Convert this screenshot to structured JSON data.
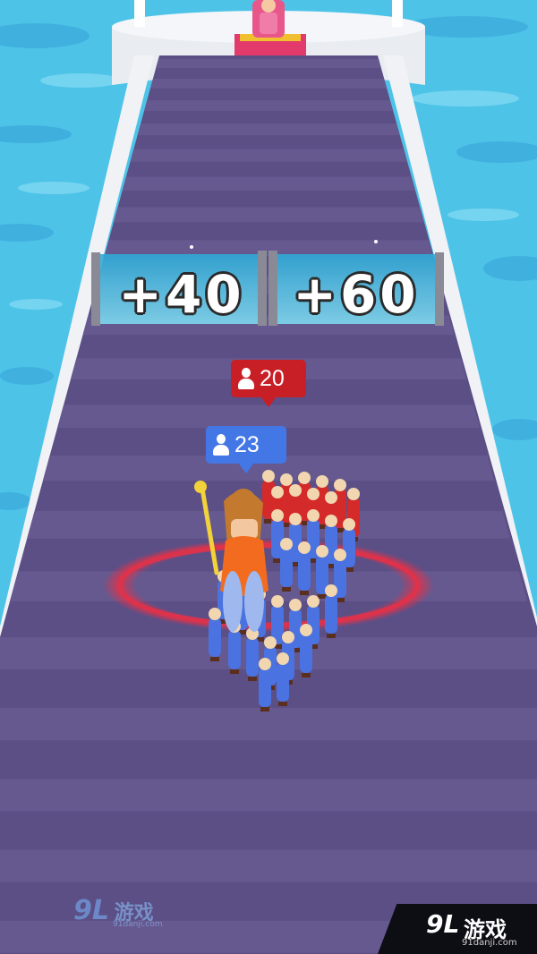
{
  "gates": [
    {
      "label": "+40"
    },
    {
      "label": "+60"
    }
  ],
  "badges": {
    "enemy_count": "20",
    "player_count": "23"
  },
  "watermark": {
    "logo": "9L",
    "brand": "游戏",
    "url": "91danji.com"
  },
  "colors": {
    "water": "#4ec3e8",
    "track": "#5c4f86",
    "gate": "#64c9e6",
    "player_team": "#4a72e0",
    "enemy_team": "#d42a2a",
    "target_ring": "#e0324a"
  }
}
